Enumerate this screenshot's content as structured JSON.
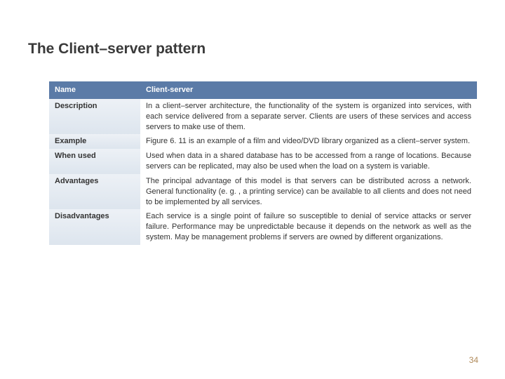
{
  "title": "The Client–server pattern",
  "header": {
    "name": "Name",
    "value": "Client-server"
  },
  "rows": [
    {
      "name": "Description",
      "value": "In a client–server architecture, the functionality of the system is organized into services, with each service delivered from a separate server. Clients are users of these services and access servers to make use of them."
    },
    {
      "name": "Example",
      "value": "Figure 6. 11 is an example of a film and video/DVD library organized as a client–server system."
    },
    {
      "name": "When used",
      "value": "Used when data in a shared database has to be accessed from a range of locations. Because servers can be replicated, may also be used when the load on a system is variable."
    },
    {
      "name": "Advantages",
      "value": "The principal advantage of this model is that servers can be distributed across a network. General functionality (e. g. , a printing service) can be available to all clients and does not need to be implemented by all services."
    },
    {
      "name": "Disadvantages",
      "value": "Each service is a single point of failure so susceptible to denial of service attacks or server failure. Performance may be unpredictable because it depends on the network as well as the system. May be management problems if servers are owned by different organizations."
    }
  ],
  "pageNumber": "34"
}
